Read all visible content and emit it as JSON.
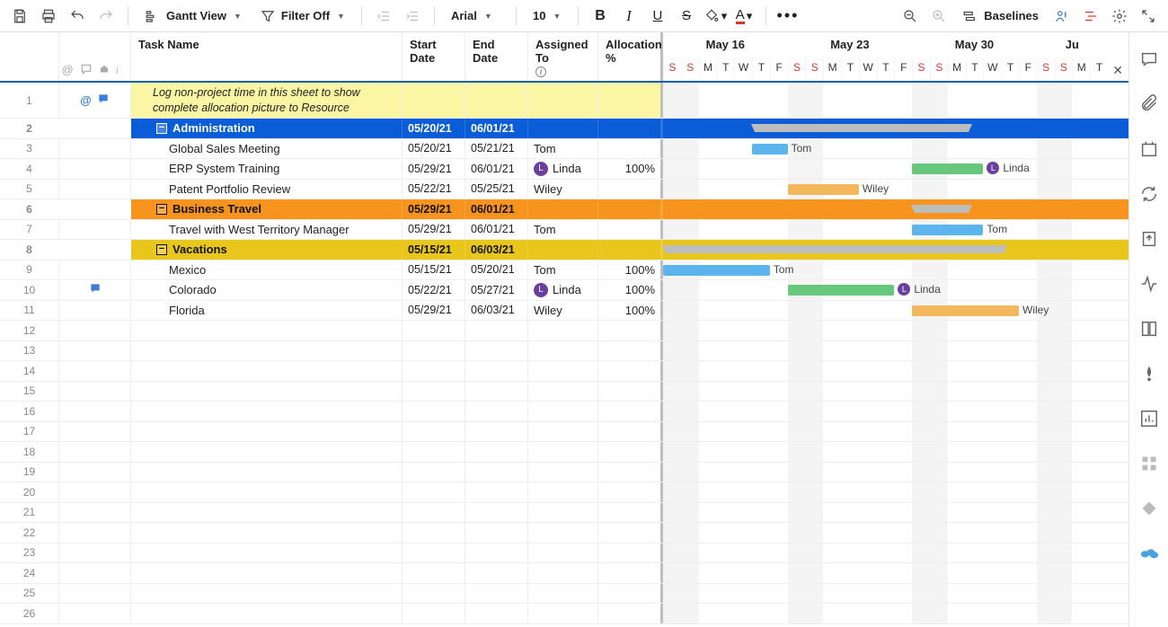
{
  "toolbar": {
    "view_label": "Gantt View",
    "filter_label": "Filter Off",
    "font": "Arial",
    "font_size": "10",
    "baselines": "Baselines"
  },
  "columns": {
    "taskname": "Task Name",
    "start": "Start Date",
    "end": "End Date",
    "assigned": "Assigned To",
    "alloc": "Allocation %"
  },
  "timeline": {
    "start": "2021-05-15",
    "months": [
      "May 16",
      "May 23",
      "May 30",
      "Ju"
    ],
    "days": [
      "S",
      "S",
      "M",
      "T",
      "W",
      "T",
      "F",
      "S",
      "S",
      "M",
      "T",
      "W",
      "T",
      "F",
      "S",
      "S",
      "M",
      "T",
      "W",
      "T",
      "F",
      "S",
      "S",
      "M",
      "T"
    ]
  },
  "rows": [
    {
      "n": 1,
      "type": "note",
      "text": "Log non-project time in this sheet to show complete allocation picture to Resource",
      "icons": [
        "link",
        "comment"
      ]
    },
    {
      "n": 2,
      "type": "group",
      "style": "blue",
      "name": "Administration",
      "start": "05/20/21",
      "end": "06/01/21",
      "bar": {
        "type": "summary",
        "from": 5,
        "to": 17
      }
    },
    {
      "n": 3,
      "type": "task",
      "name": "Global Sales Meeting",
      "start": "05/20/21",
      "end": "05/21/21",
      "assigned": "Tom",
      "bar": {
        "color": "blue",
        "from": 5,
        "to": 7,
        "label": "Tom"
      }
    },
    {
      "n": 4,
      "type": "task",
      "name": "ERP System Training",
      "start": "05/29/21",
      "end": "06/01/21",
      "assigned": "Linda",
      "avatar": "L",
      "alloc": "100%",
      "bar": {
        "color": "green",
        "from": 14,
        "to": 18,
        "label": "Linda",
        "avatar": "L"
      }
    },
    {
      "n": 5,
      "type": "task",
      "name": "Patent Portfolio Review",
      "start": "05/22/21",
      "end": "05/25/21",
      "assigned": "Wiley",
      "bar": {
        "color": "orange",
        "from": 7,
        "to": 11,
        "label": "Wiley"
      }
    },
    {
      "n": 6,
      "type": "group",
      "style": "orange",
      "name": "Business Travel",
      "start": "05/29/21",
      "end": "06/01/21",
      "bar": {
        "type": "summary",
        "from": 14,
        "to": 17
      }
    },
    {
      "n": 7,
      "type": "task",
      "name": "Travel with West Territory Manager",
      "start": "05/29/21",
      "end": "06/01/21",
      "assigned": "Tom",
      "bar": {
        "color": "blue",
        "from": 14,
        "to": 18,
        "label": "Tom"
      }
    },
    {
      "n": 8,
      "type": "group",
      "style": "yellow",
      "name": "Vacations",
      "start": "05/15/21",
      "end": "06/03/21",
      "bar": {
        "type": "summary",
        "from": 0,
        "to": 19
      }
    },
    {
      "n": 9,
      "type": "task",
      "name": "Mexico",
      "start": "05/15/21",
      "end": "05/20/21",
      "assigned": "Tom",
      "alloc": "100%",
      "bar": {
        "color": "blue",
        "from": 0,
        "to": 6,
        "label": "Tom"
      }
    },
    {
      "n": 10,
      "type": "task",
      "name": "Colorado",
      "start": "05/22/21",
      "end": "05/27/21",
      "assigned": "Linda",
      "avatar": "L",
      "alloc": "100%",
      "icons": [
        "comment"
      ],
      "bar": {
        "color": "green",
        "from": 7,
        "to": 13,
        "label": "Linda",
        "avatar": "L"
      }
    },
    {
      "n": 11,
      "type": "task",
      "name": "Florida",
      "start": "05/29/21",
      "end": "06/03/21",
      "assigned": "Wiley",
      "alloc": "100%",
      "bar": {
        "color": "orange",
        "from": 14,
        "to": 20,
        "label": "Wiley"
      }
    },
    {
      "n": 12,
      "type": "empty"
    },
    {
      "n": 13,
      "type": "empty"
    },
    {
      "n": 14,
      "type": "empty"
    },
    {
      "n": 15,
      "type": "empty"
    },
    {
      "n": 16,
      "type": "empty"
    },
    {
      "n": 17,
      "type": "empty"
    },
    {
      "n": 18,
      "type": "empty"
    },
    {
      "n": 19,
      "type": "empty"
    },
    {
      "n": 20,
      "type": "empty"
    },
    {
      "n": 21,
      "type": "empty"
    },
    {
      "n": 22,
      "type": "empty"
    },
    {
      "n": 23,
      "type": "empty"
    },
    {
      "n": 24,
      "type": "empty"
    },
    {
      "n": 25,
      "type": "empty"
    },
    {
      "n": 26,
      "type": "empty"
    }
  ],
  "dayWidth": 19.8,
  "weekendCols": [
    0,
    1,
    7,
    8,
    14,
    15,
    21,
    22
  ]
}
